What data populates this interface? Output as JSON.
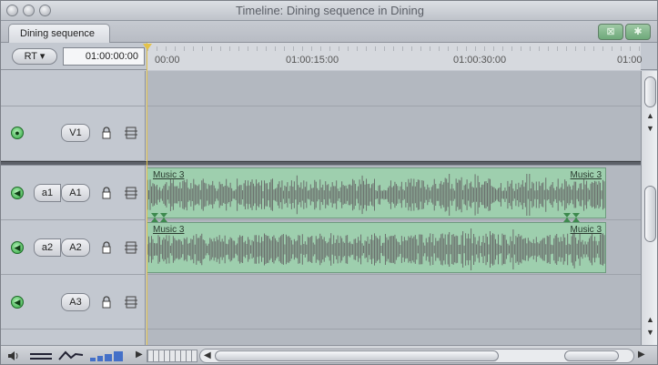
{
  "window": {
    "title": "Timeline: Dining sequence in Dining"
  },
  "tabs": [
    {
      "label": "Dining sequence"
    }
  ],
  "controls": {
    "rt_label": "RT",
    "current_timecode": "01:00:00:00"
  },
  "ruler": {
    "marks": [
      "00:00",
      "01:00:15:00",
      "01:00:30:00",
      "01:00"
    ]
  },
  "video_tracks": [
    {
      "target": "V1"
    }
  ],
  "audio_tracks": [
    {
      "source": "a1",
      "target": "A1",
      "clip": {
        "name_start": "Music 3",
        "name_end": "Music 3"
      }
    },
    {
      "source": "a2",
      "target": "A2",
      "clip": {
        "name_start": "Music 3",
        "name_end": "Music 3"
      }
    },
    {
      "target": "A3"
    }
  ],
  "colors": {
    "clip_audio": "#9ecfae",
    "playhead": "#e3c24a",
    "track_enabled": "#29a43a"
  }
}
